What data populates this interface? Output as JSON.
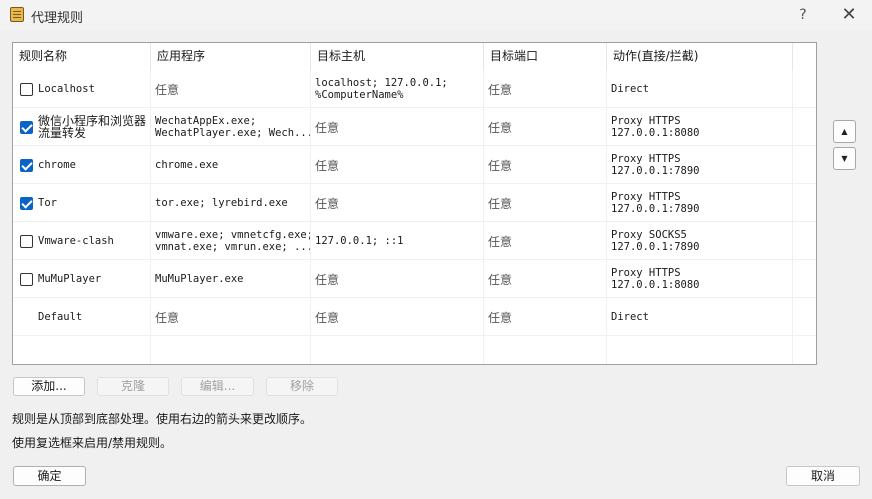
{
  "window": {
    "title": "代理规则",
    "help_label": "?",
    "close_label": "✕"
  },
  "table": {
    "columns": [
      "规则名称",
      "应用程序",
      "目标主机",
      "目标端口",
      "动作(直接/拦截)"
    ],
    "rows": [
      {
        "checked": false,
        "has_checkbox": true,
        "name": "Localhost",
        "apps": "任意",
        "hosts": "localhost; 127.0.0.1;\n%ComputerName%",
        "ports": "任意",
        "action": "Direct"
      },
      {
        "checked": true,
        "has_checkbox": true,
        "name": "微信小程序和浏览器\n流量转发",
        "apps": "WechatAppEx.exe;\nWechatPlayer.exe; Wech...",
        "hosts": "任意",
        "ports": "任意",
        "action": "Proxy HTTPS\n127.0.0.1:8080"
      },
      {
        "checked": true,
        "has_checkbox": true,
        "name": "chrome",
        "apps": "chrome.exe",
        "hosts": "任意",
        "ports": "任意",
        "action": "Proxy HTTPS\n127.0.0.1:7890"
      },
      {
        "checked": true,
        "has_checkbox": true,
        "name": "Tor",
        "apps": "tor.exe; lyrebird.exe",
        "hosts": "任意",
        "ports": "任意",
        "action": "Proxy HTTPS\n127.0.0.1:7890"
      },
      {
        "checked": false,
        "has_checkbox": true,
        "name": "Vmware-clash",
        "apps": "vmware.exe; vmnetcfg.exe;\nvmnat.exe; vmrun.exe; ...",
        "hosts": "127.0.0.1; ::1",
        "ports": "任意",
        "action": "Proxy SOCKS5\n127.0.0.1:7890"
      },
      {
        "checked": false,
        "has_checkbox": true,
        "name": "MuMuPlayer",
        "apps": "MuMuPlayer.exe",
        "hosts": "任意",
        "ports": "任意",
        "action": "Proxy HTTPS\n127.0.0.1:8080"
      },
      {
        "checked": false,
        "has_checkbox": false,
        "name": "Default",
        "apps": "任意",
        "hosts": "任意",
        "ports": "任意",
        "action": "Direct"
      }
    ]
  },
  "order_buttons": {
    "up_label": "▲",
    "down_label": "▼"
  },
  "actions": {
    "add_label": "添加...",
    "clone_label": "克隆",
    "edit_label": "编辑...",
    "remove_label": "移除"
  },
  "info": {
    "line1": "规则是从顶部到底部处理。使用右边的箭头来更改顺序。",
    "line2": "使用复选框来启用/禁用规则。"
  },
  "footer": {
    "ok_label": "确定",
    "cancel_label": "取消"
  }
}
